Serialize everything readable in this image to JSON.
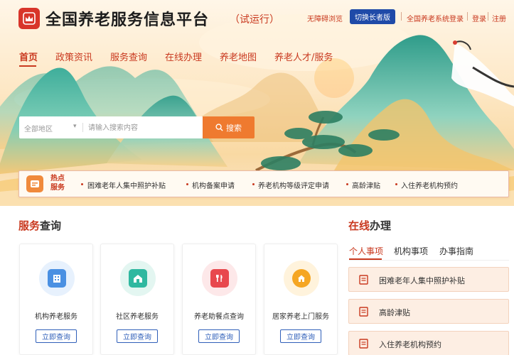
{
  "header": {
    "title": "全国养老服务信息平台",
    "badge": "（试运行）",
    "accessible_link": "无障碍浏览",
    "elder_mode_button": "切换长者版",
    "system_login": "全国养老系统登录",
    "login": "登录",
    "register": "注册"
  },
  "nav": {
    "items": [
      {
        "label": "首页"
      },
      {
        "label": "政策资讯"
      },
      {
        "label": "服务查询"
      },
      {
        "label": "在线办理"
      },
      {
        "label": "养老地图"
      },
      {
        "label": "养老人才/服务"
      }
    ],
    "active_index": 0
  },
  "search": {
    "region": "全部地区",
    "placeholder": "请输入搜索内容",
    "button": "搜索"
  },
  "hot": {
    "title_line1": "热点",
    "title_line2": "服务",
    "items": [
      {
        "label": "困难老年人集中照护补贴"
      },
      {
        "label": "机构备案申请"
      },
      {
        "label": "养老机构等级评定申请"
      },
      {
        "label": "高龄津贴"
      },
      {
        "label": "入住养老机构预约"
      }
    ]
  },
  "service_query": {
    "title_highlight": "服务",
    "title_rest": "查询",
    "cards": [
      {
        "label": "机构养老服务",
        "button": "立即查询",
        "icon": "building-icon",
        "color": "#4a90e2"
      },
      {
        "label": "社区养老服务",
        "button": "立即查询",
        "icon": "community-icon",
        "color": "#2fb8a0"
      },
      {
        "label": "养老助餐点查询",
        "button": "立即查询",
        "icon": "meal-icon",
        "color": "#e8484e"
      },
      {
        "label": "居家养老上门服务",
        "button": "立即查询",
        "icon": "home-icon",
        "color": "#f5a623"
      }
    ]
  },
  "online": {
    "title_highlight": "在线",
    "title_rest": "办理",
    "tabs": [
      {
        "label": "个人事项"
      },
      {
        "label": "机构事项"
      },
      {
        "label": "办事指南"
      }
    ],
    "active_tab": 0,
    "items": [
      {
        "label": "困难老年人集中照护补贴"
      },
      {
        "label": "高龄津贴"
      },
      {
        "label": "入住养老机构预约"
      }
    ]
  },
  "colors": {
    "brand_red": "#c9391f",
    "nav_blue": "#1f4aa8",
    "search_orange": "#ef7a2f"
  }
}
